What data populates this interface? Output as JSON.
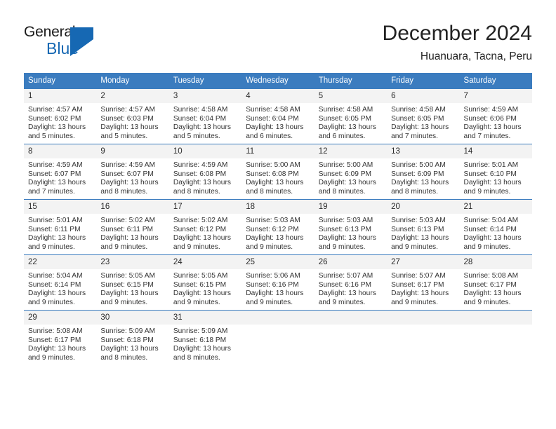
{
  "logo": {
    "word_top": "General",
    "word_bottom": "Blue",
    "icon": "triangle-icon",
    "brand_color": "#1668b3"
  },
  "header": {
    "title": "December 2024",
    "subtitle": "Huanuara, Tacna, Peru"
  },
  "theme": {
    "header_blue": "#3b7cbf",
    "daynum_bg": "#f3f3f3",
    "text": "#333333"
  },
  "weekday_headers": [
    "Sunday",
    "Monday",
    "Tuesday",
    "Wednesday",
    "Thursday",
    "Friday",
    "Saturday"
  ],
  "weeks": [
    [
      {
        "day": "1",
        "sunrise": "Sunrise: 4:57 AM",
        "sunset": "Sunset: 6:02 PM",
        "daylight1": "Daylight: 13 hours",
        "daylight2": "and 5 minutes."
      },
      {
        "day": "2",
        "sunrise": "Sunrise: 4:57 AM",
        "sunset": "Sunset: 6:03 PM",
        "daylight1": "Daylight: 13 hours",
        "daylight2": "and 5 minutes."
      },
      {
        "day": "3",
        "sunrise": "Sunrise: 4:58 AM",
        "sunset": "Sunset: 6:04 PM",
        "daylight1": "Daylight: 13 hours",
        "daylight2": "and 5 minutes."
      },
      {
        "day": "4",
        "sunrise": "Sunrise: 4:58 AM",
        "sunset": "Sunset: 6:04 PM",
        "daylight1": "Daylight: 13 hours",
        "daylight2": "and 6 minutes."
      },
      {
        "day": "5",
        "sunrise": "Sunrise: 4:58 AM",
        "sunset": "Sunset: 6:05 PM",
        "daylight1": "Daylight: 13 hours",
        "daylight2": "and 6 minutes."
      },
      {
        "day": "6",
        "sunrise": "Sunrise: 4:58 AM",
        "sunset": "Sunset: 6:05 PM",
        "daylight1": "Daylight: 13 hours",
        "daylight2": "and 7 minutes."
      },
      {
        "day": "7",
        "sunrise": "Sunrise: 4:59 AM",
        "sunset": "Sunset: 6:06 PM",
        "daylight1": "Daylight: 13 hours",
        "daylight2": "and 7 minutes."
      }
    ],
    [
      {
        "day": "8",
        "sunrise": "Sunrise: 4:59 AM",
        "sunset": "Sunset: 6:07 PM",
        "daylight1": "Daylight: 13 hours",
        "daylight2": "and 7 minutes."
      },
      {
        "day": "9",
        "sunrise": "Sunrise: 4:59 AM",
        "sunset": "Sunset: 6:07 PM",
        "daylight1": "Daylight: 13 hours",
        "daylight2": "and 8 minutes."
      },
      {
        "day": "10",
        "sunrise": "Sunrise: 4:59 AM",
        "sunset": "Sunset: 6:08 PM",
        "daylight1": "Daylight: 13 hours",
        "daylight2": "and 8 minutes."
      },
      {
        "day": "11",
        "sunrise": "Sunrise: 5:00 AM",
        "sunset": "Sunset: 6:08 PM",
        "daylight1": "Daylight: 13 hours",
        "daylight2": "and 8 minutes."
      },
      {
        "day": "12",
        "sunrise": "Sunrise: 5:00 AM",
        "sunset": "Sunset: 6:09 PM",
        "daylight1": "Daylight: 13 hours",
        "daylight2": "and 8 minutes."
      },
      {
        "day": "13",
        "sunrise": "Sunrise: 5:00 AM",
        "sunset": "Sunset: 6:09 PM",
        "daylight1": "Daylight: 13 hours",
        "daylight2": "and 8 minutes."
      },
      {
        "day": "14",
        "sunrise": "Sunrise: 5:01 AM",
        "sunset": "Sunset: 6:10 PM",
        "daylight1": "Daylight: 13 hours",
        "daylight2": "and 9 minutes."
      }
    ],
    [
      {
        "day": "15",
        "sunrise": "Sunrise: 5:01 AM",
        "sunset": "Sunset: 6:11 PM",
        "daylight1": "Daylight: 13 hours",
        "daylight2": "and 9 minutes."
      },
      {
        "day": "16",
        "sunrise": "Sunrise: 5:02 AM",
        "sunset": "Sunset: 6:11 PM",
        "daylight1": "Daylight: 13 hours",
        "daylight2": "and 9 minutes."
      },
      {
        "day": "17",
        "sunrise": "Sunrise: 5:02 AM",
        "sunset": "Sunset: 6:12 PM",
        "daylight1": "Daylight: 13 hours",
        "daylight2": "and 9 minutes."
      },
      {
        "day": "18",
        "sunrise": "Sunrise: 5:03 AM",
        "sunset": "Sunset: 6:12 PM",
        "daylight1": "Daylight: 13 hours",
        "daylight2": "and 9 minutes."
      },
      {
        "day": "19",
        "sunrise": "Sunrise: 5:03 AM",
        "sunset": "Sunset: 6:13 PM",
        "daylight1": "Daylight: 13 hours",
        "daylight2": "and 9 minutes."
      },
      {
        "day": "20",
        "sunrise": "Sunrise: 5:03 AM",
        "sunset": "Sunset: 6:13 PM",
        "daylight1": "Daylight: 13 hours",
        "daylight2": "and 9 minutes."
      },
      {
        "day": "21",
        "sunrise": "Sunrise: 5:04 AM",
        "sunset": "Sunset: 6:14 PM",
        "daylight1": "Daylight: 13 hours",
        "daylight2": "and 9 minutes."
      }
    ],
    [
      {
        "day": "22",
        "sunrise": "Sunrise: 5:04 AM",
        "sunset": "Sunset: 6:14 PM",
        "daylight1": "Daylight: 13 hours",
        "daylight2": "and 9 minutes."
      },
      {
        "day": "23",
        "sunrise": "Sunrise: 5:05 AM",
        "sunset": "Sunset: 6:15 PM",
        "daylight1": "Daylight: 13 hours",
        "daylight2": "and 9 minutes."
      },
      {
        "day": "24",
        "sunrise": "Sunrise: 5:05 AM",
        "sunset": "Sunset: 6:15 PM",
        "daylight1": "Daylight: 13 hours",
        "daylight2": "and 9 minutes."
      },
      {
        "day": "25",
        "sunrise": "Sunrise: 5:06 AM",
        "sunset": "Sunset: 6:16 PM",
        "daylight1": "Daylight: 13 hours",
        "daylight2": "and 9 minutes."
      },
      {
        "day": "26",
        "sunrise": "Sunrise: 5:07 AM",
        "sunset": "Sunset: 6:16 PM",
        "daylight1": "Daylight: 13 hours",
        "daylight2": "and 9 minutes."
      },
      {
        "day": "27",
        "sunrise": "Sunrise: 5:07 AM",
        "sunset": "Sunset: 6:17 PM",
        "daylight1": "Daylight: 13 hours",
        "daylight2": "and 9 minutes."
      },
      {
        "day": "28",
        "sunrise": "Sunrise: 5:08 AM",
        "sunset": "Sunset: 6:17 PM",
        "daylight1": "Daylight: 13 hours",
        "daylight2": "and 9 minutes."
      }
    ],
    [
      {
        "day": "29",
        "sunrise": "Sunrise: 5:08 AM",
        "sunset": "Sunset: 6:17 PM",
        "daylight1": "Daylight: 13 hours",
        "daylight2": "and 9 minutes."
      },
      {
        "day": "30",
        "sunrise": "Sunrise: 5:09 AM",
        "sunset": "Sunset: 6:18 PM",
        "daylight1": "Daylight: 13 hours",
        "daylight2": "and 8 minutes."
      },
      {
        "day": "31",
        "sunrise": "Sunrise: 5:09 AM",
        "sunset": "Sunset: 6:18 PM",
        "daylight1": "Daylight: 13 hours",
        "daylight2": "and 8 minutes."
      },
      {
        "day": "",
        "sunrise": "",
        "sunset": "",
        "daylight1": "",
        "daylight2": ""
      },
      {
        "day": "",
        "sunrise": "",
        "sunset": "",
        "daylight1": "",
        "daylight2": ""
      },
      {
        "day": "",
        "sunrise": "",
        "sunset": "",
        "daylight1": "",
        "daylight2": ""
      },
      {
        "day": "",
        "sunrise": "",
        "sunset": "",
        "daylight1": "",
        "daylight2": ""
      }
    ]
  ]
}
